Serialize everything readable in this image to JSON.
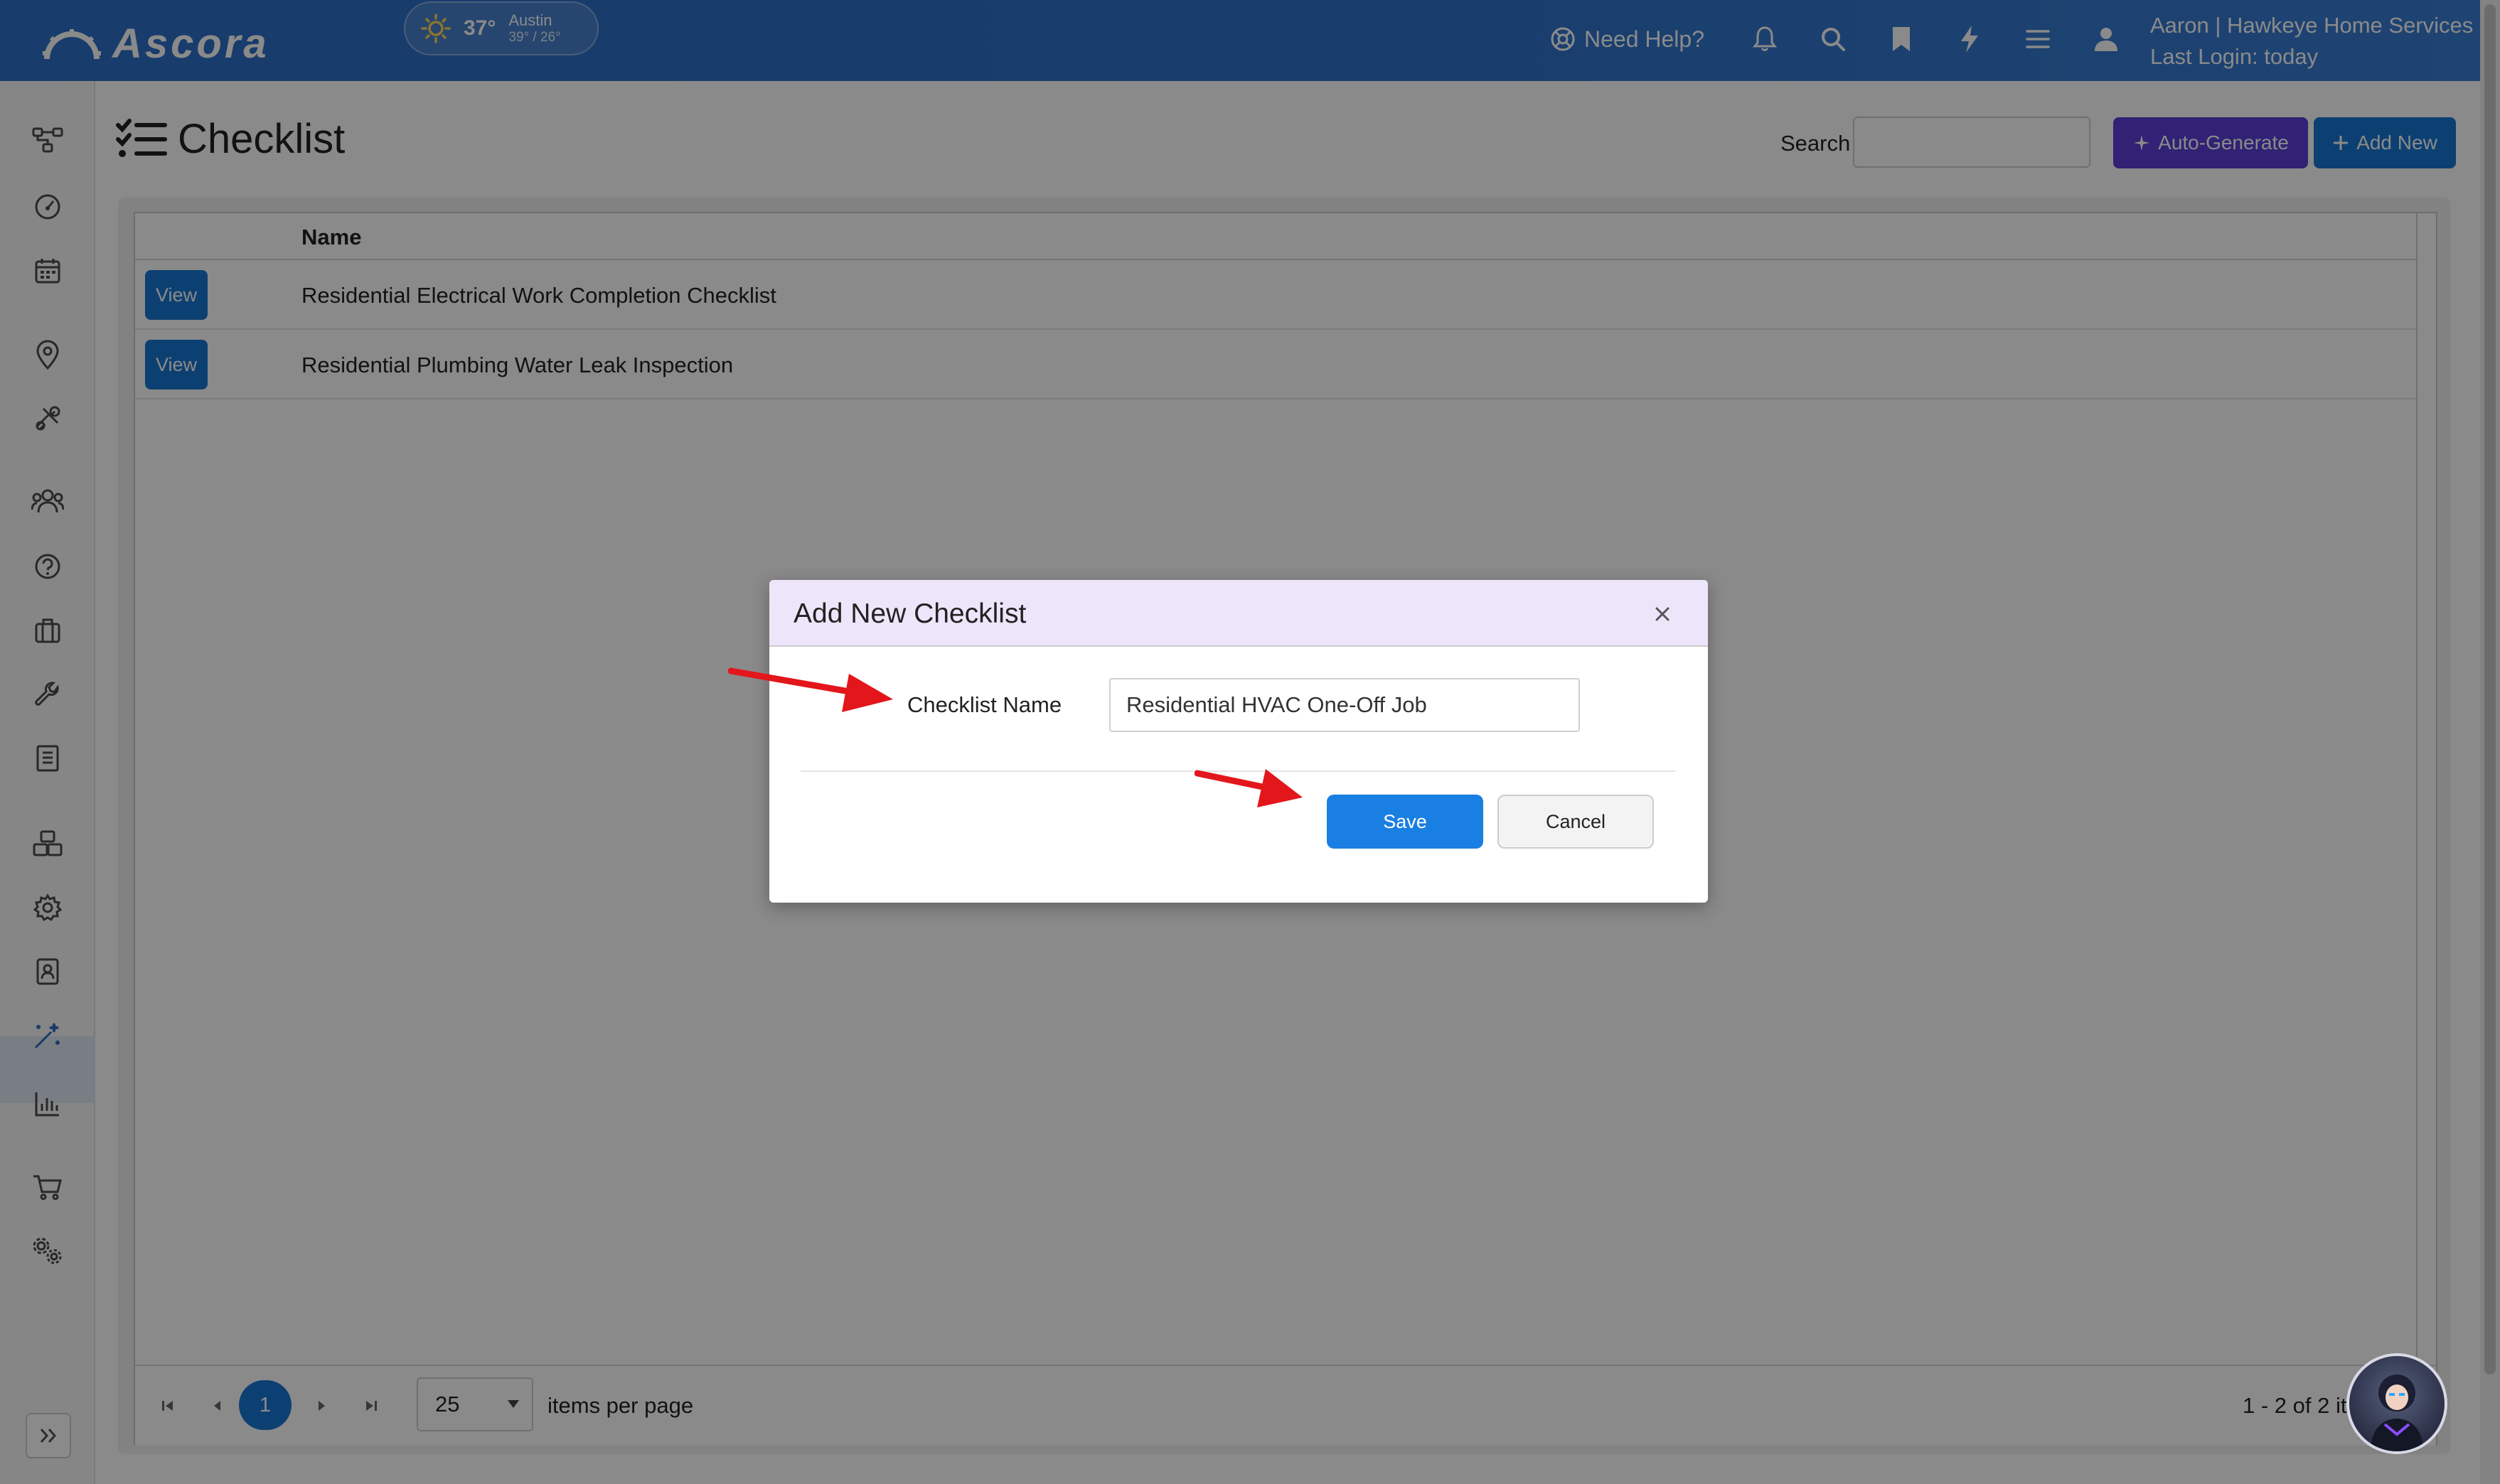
{
  "app": {
    "logo_text": "Ascora"
  },
  "weather": {
    "temp": "37°",
    "city": "Austin",
    "range": "39° / 26°",
    "icon": "sun-icon"
  },
  "header": {
    "need_help": "Need Help?",
    "icons": [
      "bell-icon",
      "search-icon",
      "bookmark-icon",
      "lightning-icon",
      "menu-icon",
      "user-icon"
    ],
    "user_line1": "Aaron | Hawkeye Home Services",
    "user_line2": "Last Login: today"
  },
  "sidebar": {
    "icons": [
      "workflow-icon",
      "dashboard-icon",
      "calendar-icon",
      "location-icon",
      "tools-icon",
      "customers-icon",
      "help-icon",
      "briefcase-icon",
      "wrench-icon",
      "book-icon",
      "inventory-icon",
      "settings-icon",
      "contacts-icon",
      "magic-wand-icon",
      "reports-icon",
      "cart-icon",
      "admin-settings-icon"
    ],
    "active": "magic-wand-icon"
  },
  "page": {
    "title": "Checklist",
    "search_label": "Search",
    "search_value": "",
    "auto_generate": "Auto-Generate",
    "add_new": "Add New"
  },
  "grid": {
    "column_name": "Name",
    "rows": [
      {
        "action": "View",
        "name": "Residential Electrical Work Completion Checklist"
      },
      {
        "action": "View",
        "name": "Residential Plumbing Water Leak Inspection"
      }
    ],
    "pager": {
      "current_page": "1",
      "per_page": "25",
      "per_page_label": "items per page",
      "count_text": "1 - 2 of 2 item."
    }
  },
  "modal": {
    "title": "Add New Checklist",
    "field_label": "Checklist Name",
    "field_value": "Residential HVAC One-Off Job",
    "save": "Save",
    "cancel": "Cancel"
  },
  "colors": {
    "header_blue": "#2f74cc",
    "primary": "#1976d2",
    "auto_generate": "#5b3fd9",
    "annotation_arrow": "#e3161b"
  }
}
